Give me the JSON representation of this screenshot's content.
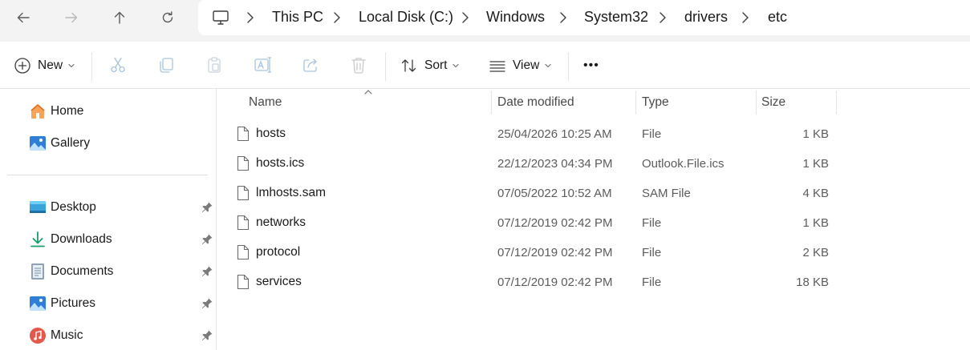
{
  "nav": {
    "back": "arrow-left-icon",
    "forward": "arrow-right-icon",
    "up": "arrow-up-icon",
    "refresh": "refresh-icon"
  },
  "breadcrumb": {
    "root_icon": "computer-icon",
    "items": [
      "This PC",
      "Local Disk (C:)",
      "Windows",
      "System32",
      "drivers",
      "etc"
    ]
  },
  "toolbar": {
    "new_label": "New",
    "sort_label": "Sort",
    "view_label": "View",
    "more_label": "•••"
  },
  "sidebar": {
    "top_items": [
      {
        "label": "Home",
        "icon": "home-icon"
      },
      {
        "label": "Gallery",
        "icon": "gallery-icon"
      }
    ],
    "quick_access": [
      {
        "label": "Desktop",
        "icon": "desktop-folder-icon",
        "pinned": true
      },
      {
        "label": "Downloads",
        "icon": "downloads-icon",
        "pinned": true
      },
      {
        "label": "Documents",
        "icon": "documents-icon",
        "pinned": true
      },
      {
        "label": "Pictures",
        "icon": "pictures-icon",
        "pinned": true
      },
      {
        "label": "Music",
        "icon": "music-icon",
        "pinned": true
      }
    ]
  },
  "files": {
    "columns": {
      "name": "Name",
      "date": "Date modified",
      "type": "Type",
      "size": "Size"
    },
    "rows": [
      {
        "name": "hosts",
        "date": "25/04/2026 10:25 AM",
        "type": "File",
        "size": "1 KB"
      },
      {
        "name": "hosts.ics",
        "date": "22/12/2023 04:34 PM",
        "type": "Outlook.File.ics",
        "size": "1 KB"
      },
      {
        "name": "lmhosts.sam",
        "date": "07/05/2022 10:52 AM",
        "type": "SAM File",
        "size": "4 KB"
      },
      {
        "name": "networks",
        "date": "07/12/2019 02:42 PM",
        "type": "File",
        "size": "1 KB"
      },
      {
        "name": "protocol",
        "date": "07/12/2019 02:42 PM",
        "type": "File",
        "size": "2 KB"
      },
      {
        "name": "services",
        "date": "07/12/2019 02:42 PM",
        "type": "File",
        "size": "18 KB"
      }
    ]
  },
  "colors": {
    "accent": "#0067c0",
    "chrome_bg": "#f3f3f3",
    "disabled_icon": "#a9c4dc"
  }
}
